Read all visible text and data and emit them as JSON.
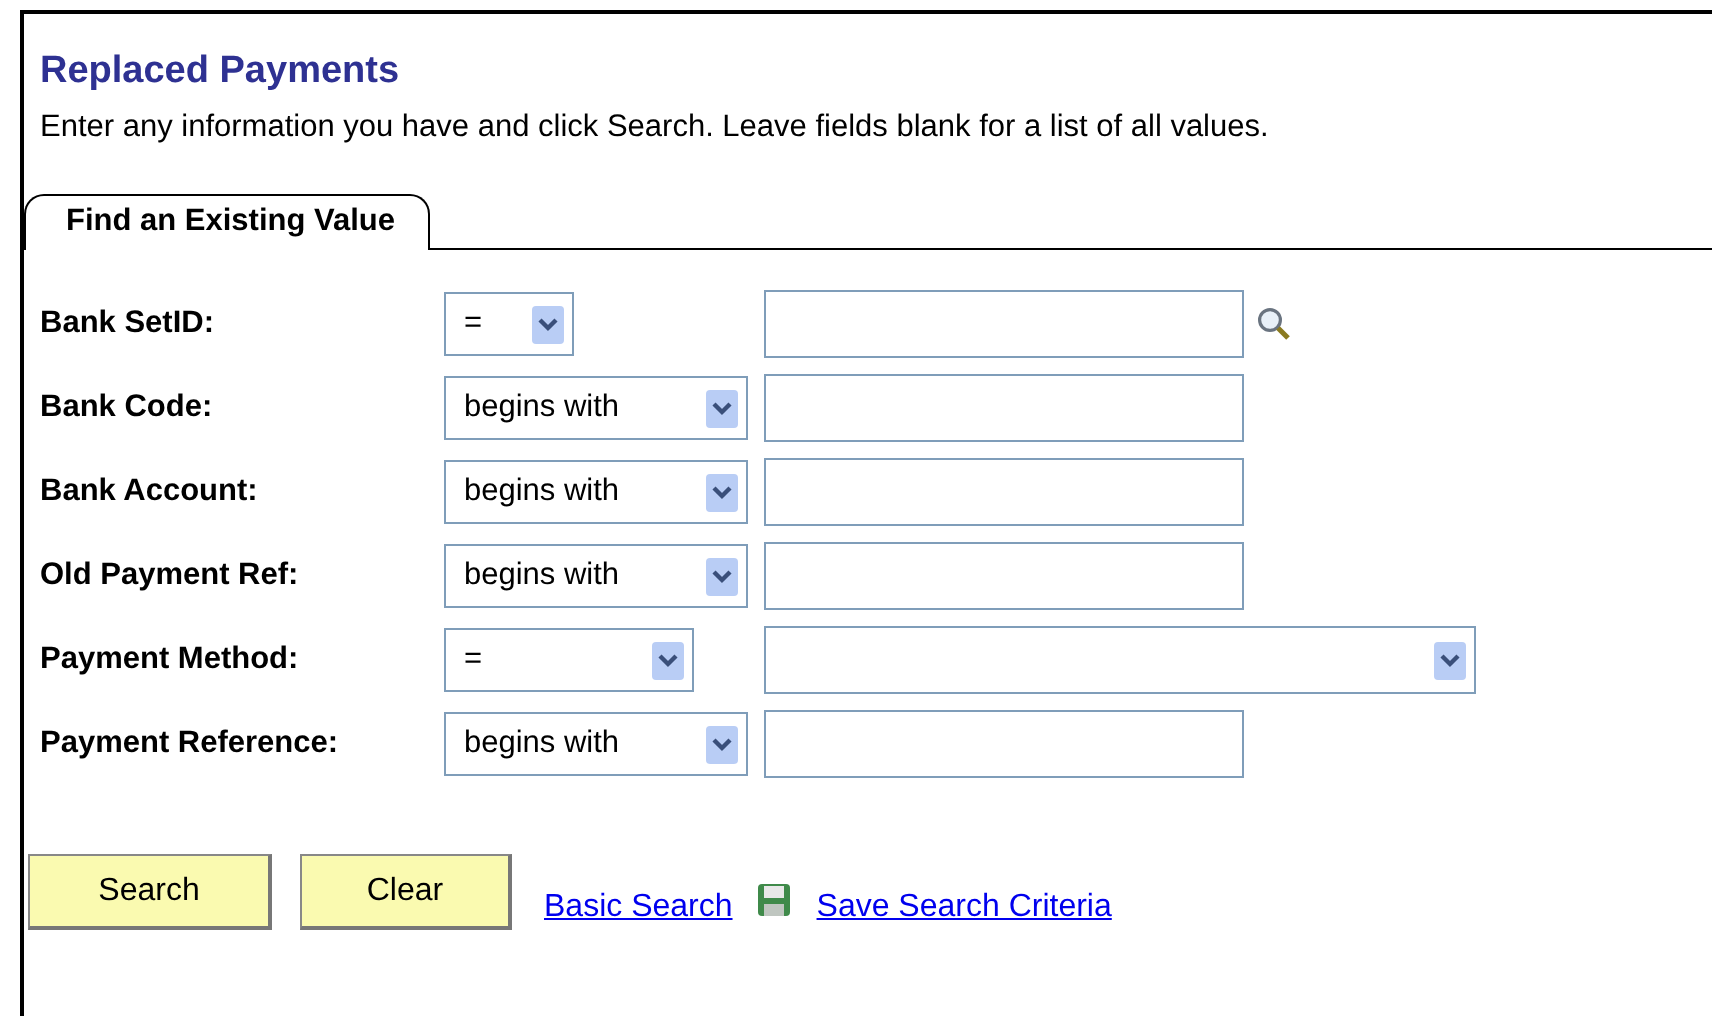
{
  "title": "Replaced Payments",
  "instructions": "Enter any information you have and click Search. Leave fields blank for a list of all values.",
  "tabs": [
    {
      "label": "Find an Existing Value",
      "selected": true
    }
  ],
  "rows": [
    {
      "label": "Bank SetID:",
      "operator": "=",
      "kind": "lookup"
    },
    {
      "label": "Bank Code:",
      "operator": "begins with",
      "kind": "text"
    },
    {
      "label": "Bank Account:",
      "operator": "begins with",
      "kind": "text"
    },
    {
      "label": "Old Payment Ref:",
      "operator": "begins with",
      "kind": "text"
    },
    {
      "label": "Payment Method:",
      "operator": "=",
      "kind": "select"
    },
    {
      "label": "Payment Reference:",
      "operator": "begins with",
      "kind": "text"
    }
  ],
  "buttons": [
    "Search",
    "Clear"
  ],
  "links": [
    {
      "label": "Basic Search",
      "kind": "link"
    },
    {
      "label": "Save Search Criteria",
      "kind": "save"
    }
  ]
}
